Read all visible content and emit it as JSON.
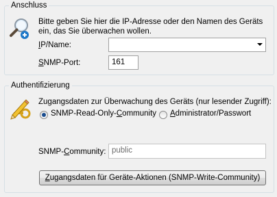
{
  "connection": {
    "group_label": "Anschluss",
    "description": "Bitte geben Sie hier die IP-Adresse oder den Namen des Geräts ein, das Sie überwachen wollen.",
    "ip_label_key": "I",
    "ip_label_rest": "P/Name:",
    "ip_value": "",
    "port_label_key": "S",
    "port_label_rest": "NMP-Port:",
    "port_value": "161",
    "icon": "magnifier-plus-icon"
  },
  "auth": {
    "group_label": "Authentifizierung",
    "description": "Zugangsdaten zur Überwachung des Geräts (nur lesender Zugriff):",
    "radio_community_pre": "SNMP-Read-Only-",
    "radio_community_key": "C",
    "radio_community_post": "ommunity",
    "radio_admin_key": "A",
    "radio_admin_rest": "dministrator/Passwort",
    "selected": "community",
    "community_label_pre": "SNMP-",
    "community_label_key": "C",
    "community_label_post": "ommunity:",
    "community_value": "public",
    "write_button_key": "Z",
    "write_button_rest": "ugangsdaten für Geräte-Aktionen (SNMP-Write-Community)",
    "icon": "pencil-key-icon"
  }
}
